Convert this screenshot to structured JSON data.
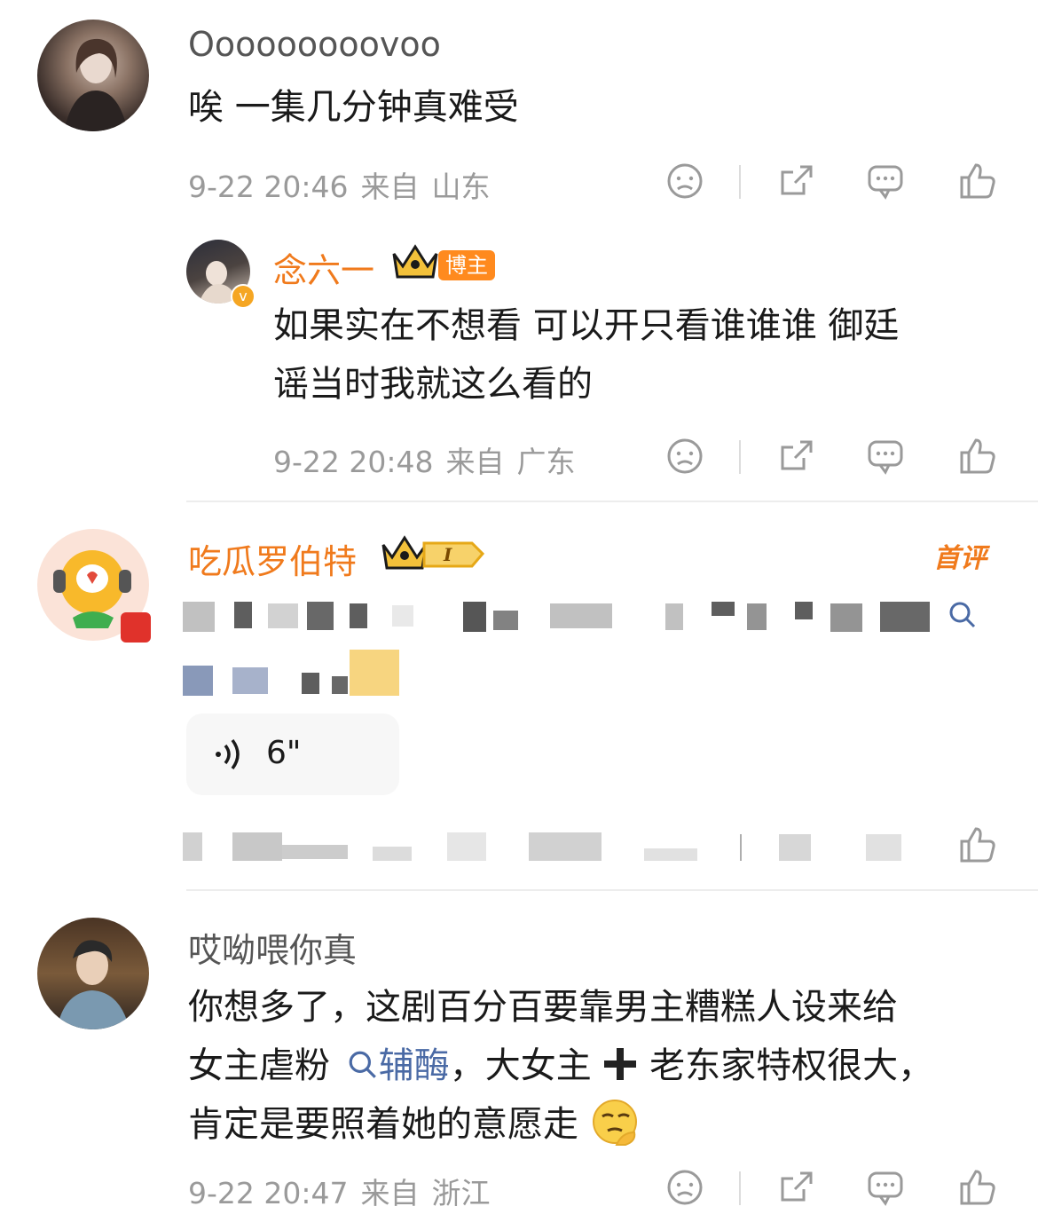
{
  "colors": {
    "accent_orange": "#f07a1c",
    "link_blue": "#4a6aa5",
    "meta_gray": "#9a9a9a"
  },
  "icons": {
    "dislike": "sad-face-icon",
    "share": "share-icon",
    "reply": "comment-bubble-icon",
    "like": "thumbs-up-icon"
  },
  "comment1": {
    "username": "Ooooooooovoo",
    "text": "唉 一集几分钟真难受",
    "time": "9-22 20:46",
    "from": "来自",
    "location": "山东"
  },
  "reply1": {
    "username": "念六一",
    "host_badge": "博主",
    "crown_level": "I",
    "text_line1": "如果实在不想看 可以开只看谁谁谁 御廷",
    "text_line2": "谣当时我就这么看的",
    "time": "9-22 20:48",
    "from": "来自",
    "location": "广东"
  },
  "comment2": {
    "username": "吃瓜罗伯特",
    "crown_level": "I",
    "first_label": "首评",
    "voice_duration": "6\""
  },
  "comment3": {
    "username": "哎呦喂你真",
    "text_line1": "你想多了，这剧百分百要靠男主糟糕人设来给",
    "text_line2_a": "女主虐粉",
    "topic": "辅酶",
    "text_line2_b": "，大女主",
    "text_line2_c": "老东家特权很大，",
    "text_line3": "肯定是要照着她的意愿走",
    "time": "9-22 20:47",
    "from": "来自",
    "location": "浙江"
  }
}
